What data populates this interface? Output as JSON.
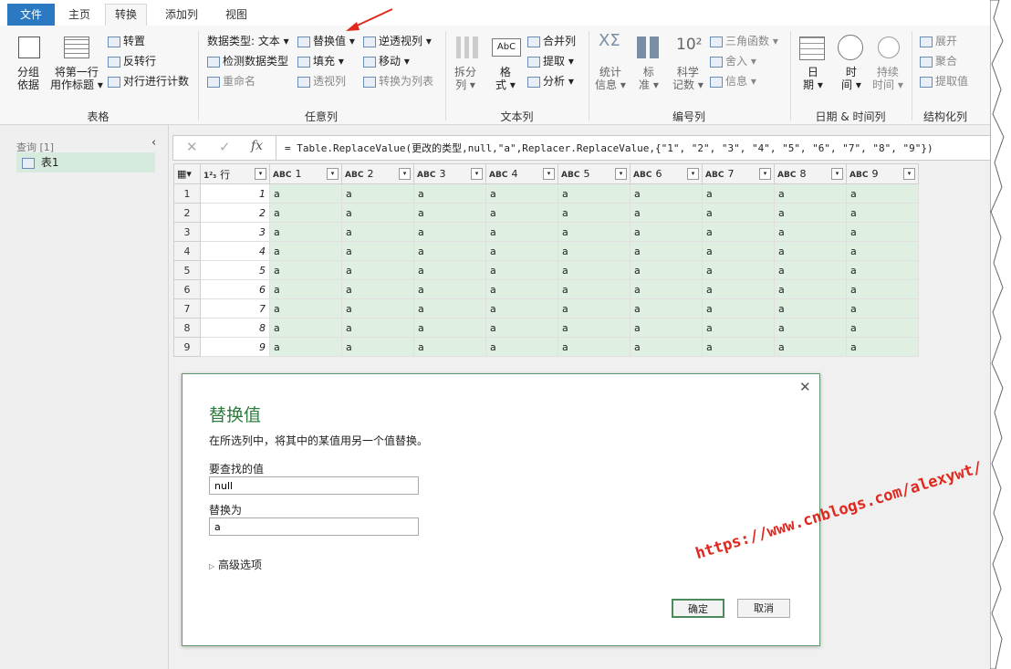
{
  "tabs": {
    "file": "文件",
    "home": "主页",
    "transform": "转换",
    "add_column": "添加列",
    "view": "视图"
  },
  "ribbon": {
    "table_group": {
      "label": "表格",
      "group_by": [
        "分组",
        "依据"
      ],
      "first_row_header": [
        "将第一行",
        "用作标题 ▾"
      ],
      "transpose": "转置",
      "reverse_rows": "反转行",
      "count_rows": "对行进行计数"
    },
    "any_column_group": {
      "label": "任意列",
      "data_type": "数据类型: 文本 ▾",
      "detect_type": "检测数据类型",
      "rename": "重命名",
      "replace_values": "替换值 ▾",
      "fill": "填充 ▾",
      "pivot": "透视列",
      "unpivot": "逆透视列 ▾",
      "move": "移动 ▾",
      "to_list": "转换为列表"
    },
    "text_column_group": {
      "label": "文本列",
      "split": [
        "拆分",
        "列 ▾"
      ],
      "format": [
        "格",
        "式 ▾"
      ],
      "merge": "合并列",
      "extract": "提取 ▾",
      "parse": "分析 ▾"
    },
    "number_column_group": {
      "label": "编号列",
      "statistics": [
        "统计",
        "信息 ▾"
      ],
      "standard": [
        "标",
        "准 ▾"
      ],
      "scientific": [
        "科学",
        "记数 ▾"
      ],
      "trig": "三角函数 ▾",
      "rounding": "舍入 ▾",
      "info": "信息 ▾"
    },
    "datetime_group": {
      "label": "日期 & 时间列",
      "date": [
        "日",
        "期 ▾"
      ],
      "time": [
        "时",
        "间 ▾"
      ],
      "duration": [
        "持续",
        "时间 ▾"
      ]
    },
    "structured_group": {
      "label": "结构化列",
      "expand": "展开",
      "aggregate": "聚合",
      "extract_values": "提取值"
    }
  },
  "queries": {
    "header": "查询 [1]",
    "items": [
      "表1"
    ]
  },
  "formula": "= Table.ReplaceValue(更改的类型,null,\"a\",Replacer.ReplaceValue,{\"1\", \"2\", \"3\", \"4\", \"5\", \"6\", \"7\", \"8\", \"9\"})",
  "grid": {
    "row_col_header": "行",
    "columns": [
      "1",
      "2",
      "3",
      "4",
      "5",
      "6",
      "7",
      "8",
      "9"
    ],
    "rows": [
      {
        "n": "1",
        "v": "1",
        "cells": [
          "a",
          "a",
          "a",
          "a",
          "a",
          "a",
          "a",
          "a",
          "a"
        ]
      },
      {
        "n": "2",
        "v": "2",
        "cells": [
          "a",
          "a",
          "a",
          "a",
          "a",
          "a",
          "a",
          "a",
          "a"
        ]
      },
      {
        "n": "3",
        "v": "3",
        "cells": [
          "a",
          "a",
          "a",
          "a",
          "a",
          "a",
          "a",
          "a",
          "a"
        ]
      },
      {
        "n": "4",
        "v": "4",
        "cells": [
          "a",
          "a",
          "a",
          "a",
          "a",
          "a",
          "a",
          "a",
          "a"
        ]
      },
      {
        "n": "5",
        "v": "5",
        "cells": [
          "a",
          "a",
          "a",
          "a",
          "a",
          "a",
          "a",
          "a",
          "a"
        ]
      },
      {
        "n": "6",
        "v": "6",
        "cells": [
          "a",
          "a",
          "a",
          "a",
          "a",
          "a",
          "a",
          "a",
          "a"
        ]
      },
      {
        "n": "7",
        "v": "7",
        "cells": [
          "a",
          "a",
          "a",
          "a",
          "a",
          "a",
          "a",
          "a",
          "a"
        ]
      },
      {
        "n": "8",
        "v": "8",
        "cells": [
          "a",
          "a",
          "a",
          "a",
          "a",
          "a",
          "a",
          "a",
          "a"
        ]
      },
      {
        "n": "9",
        "v": "9",
        "cells": [
          "a",
          "a",
          "a",
          "a",
          "a",
          "a",
          "a",
          "a",
          "a"
        ]
      }
    ]
  },
  "dialog": {
    "title": "替换值",
    "description": "在所选列中，将其中的某值用另一个值替换。",
    "find_label": "要查找的值",
    "find_value": "null",
    "replace_label": "替换为",
    "replace_value": "a",
    "advanced": "高级选项",
    "ok": "确定",
    "cancel": "取消"
  },
  "watermark": "https://www.cnblogs.com/alexywt/",
  "colors": {
    "accent": "#2b79c2",
    "dialog_title": "#2f7a3f",
    "highlight_cells": "#dff0e3",
    "annotation": "#e0281e"
  }
}
